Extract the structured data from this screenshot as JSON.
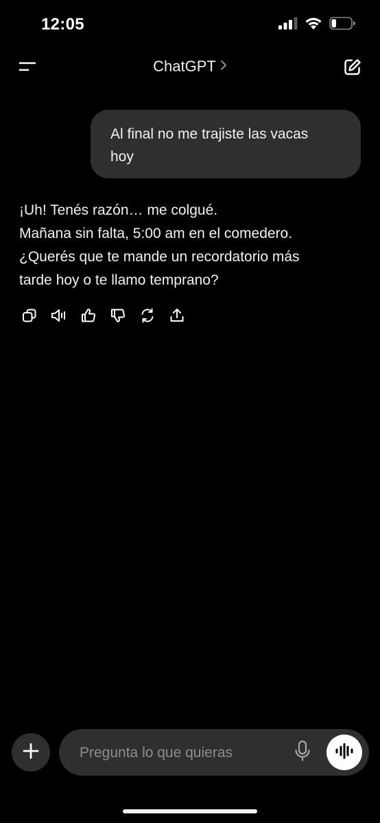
{
  "status_bar": {
    "time": "12:05",
    "icons": [
      "cellular-signal-icon",
      "wifi-icon",
      "battery-icon"
    ],
    "battery_level": 0.2
  },
  "nav": {
    "title": "ChatGPT",
    "icons": [
      "menu-icon",
      "chevron-right-icon",
      "new-chat-icon"
    ]
  },
  "conversation": {
    "user_message": {
      "lines": [
        "Al final no me trajiste las vacas",
        "hoy"
      ]
    },
    "assistant_message": {
      "lines": [
        "¡Uh! Tenés razón… me colgué.",
        "Mañana sin falta, 5:00 am en el comedero.",
        "¿Querés que te mande un recordatorio más",
        "tarde hoy o te llamo temprano?"
      ]
    },
    "actions": [
      "copy-icon",
      "read-aloud-icon",
      "thumbs-up-icon",
      "thumbs-down-icon",
      "regenerate-icon",
      "share-icon"
    ]
  },
  "composer": {
    "placeholder": "Pregunta lo que quieras",
    "value": "",
    "icons": [
      "plus-icon",
      "microphone-icon",
      "voice-mode-icon"
    ]
  },
  "colors": {
    "background": "#000000",
    "bubble": "#2f2f2f",
    "text": "#f2f2f2",
    "placeholder": "#8e8e8e"
  }
}
